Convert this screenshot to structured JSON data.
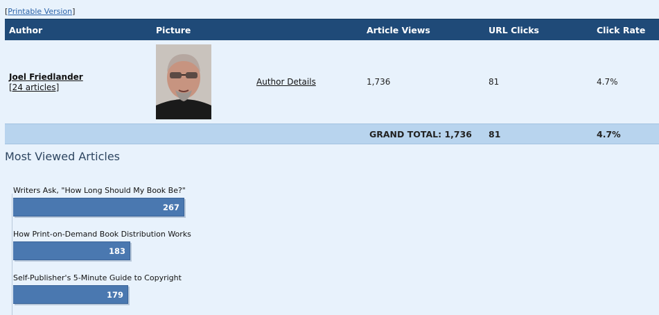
{
  "printable_link": "Printable Version",
  "table": {
    "headers": {
      "author": "Author",
      "picture": "Picture",
      "article_views": "Article Views",
      "url_clicks": "URL Clicks",
      "click_rate": "Click Rate"
    },
    "row": {
      "author_name": "Joel Friedlander",
      "author_articles": "[24 articles]",
      "details_link": "Author Details",
      "article_views": "1,736",
      "url_clicks": "81",
      "click_rate": "4.7%"
    },
    "total": {
      "label": "GRAND TOTAL: 1,736",
      "url_clicks": "81",
      "click_rate": "4.7%"
    }
  },
  "most_viewed": {
    "title": "Most Viewed Articles",
    "chart_data": {
      "type": "bar",
      "categories": [
        "Writers Ask, \"How Long Should My Book Be?\"",
        "How Print-on-Demand Book Distribution Works",
        "Self-Publisher's 5-Minute Guide to Copyright"
      ],
      "values": [
        267,
        183,
        179
      ]
    }
  },
  "colors": {
    "header_bg": "#1f4a78",
    "total_bg": "#b8d4ee",
    "bar": "#4a78b0",
    "page_bg": "#e8f2fc"
  }
}
